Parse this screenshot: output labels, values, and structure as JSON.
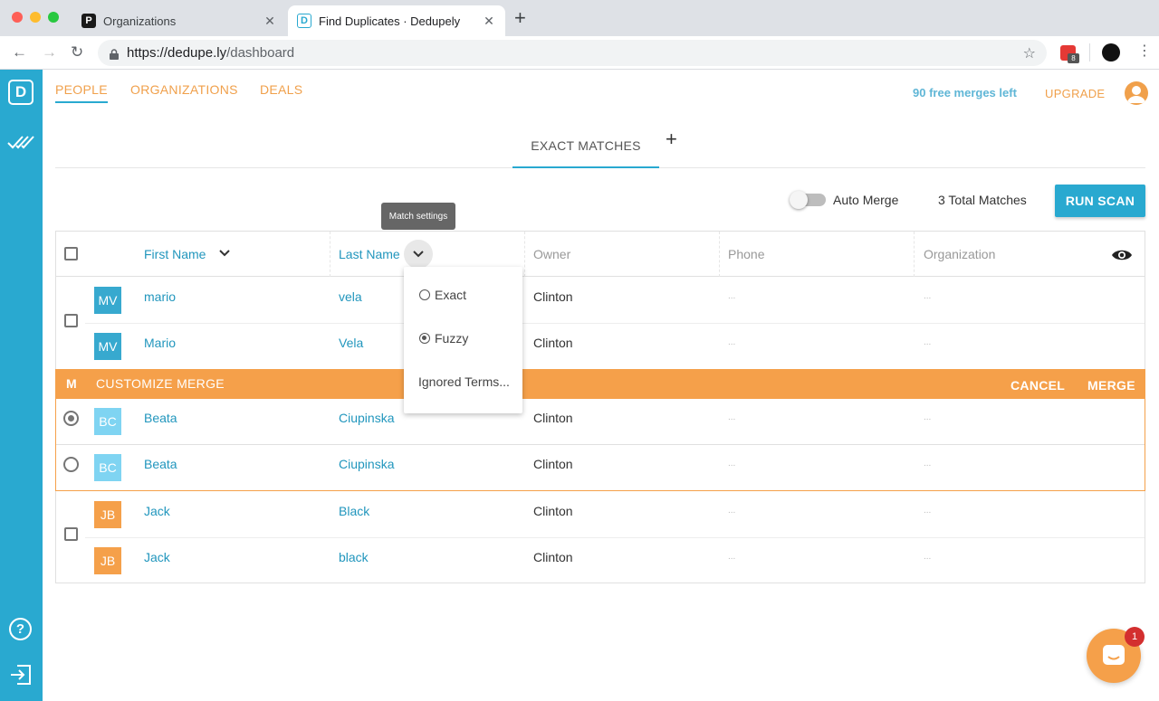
{
  "browser": {
    "tabs": [
      {
        "label": "Organizations",
        "favicon": "P"
      },
      {
        "label": "Find Duplicates · Dedupely",
        "favicon": "D"
      }
    ],
    "url_host": "https://dedupe.ly",
    "url_path": "/dashboard",
    "extension_badge": "8"
  },
  "sidebar": {
    "logo": "D",
    "help": "?"
  },
  "nav": {
    "tabs": [
      "PEOPLE",
      "ORGANIZATIONS",
      "DEALS"
    ],
    "free_merges": "90 free merges left",
    "upgrade": "UPGRADE"
  },
  "subtabs": {
    "exact": "EXACT MATCHES",
    "add": "+"
  },
  "tooltip": "Match settings",
  "toolbar": {
    "auto_merge_label": "Auto Merge",
    "auto_merge_on": false,
    "total_matches": "3 Total Matches",
    "run_scan": "RUN SCAN"
  },
  "table": {
    "columns": [
      "First Name",
      "Last Name",
      "Owner",
      "Phone",
      "Organization"
    ],
    "rows": [
      {
        "initials": "MV",
        "first": "mario",
        "last": "vela",
        "owner": "Clinton",
        "phone": "...",
        "org": "...",
        "color": "#37a9cf"
      },
      {
        "initials": "MV",
        "first": "Mario",
        "last": "Vela",
        "owner": "Clinton",
        "phone": "...",
        "org": "...",
        "color": "#37a9cf"
      },
      {
        "initials": "BC",
        "first": "Beata",
        "last": "Ciupinska",
        "owner": "Clinton",
        "phone": "...",
        "org": "...",
        "color": "#7fd4f2"
      },
      {
        "initials": "BC",
        "first": "Beata",
        "last": "Ciupinska",
        "owner": "Clinton",
        "phone": "...",
        "org": "...",
        "color": "#7fd4f2"
      },
      {
        "initials": "JB",
        "first": "Jack",
        "last": "Black",
        "owner": "Clinton",
        "phone": "...",
        "org": "...",
        "color": "#f5a04a"
      },
      {
        "initials": "JB",
        "first": "Jack",
        "last": "black",
        "owner": "Clinton",
        "phone": "...",
        "org": "...",
        "color": "#f5a04a"
      }
    ]
  },
  "merge_bar": {
    "badge": "M",
    "title": "CUSTOMIZE MERGE",
    "cancel": "CANCEL",
    "merge": "MERGE"
  },
  "dropdown": {
    "options": [
      "Exact",
      "Fuzzy"
    ],
    "selected": "Fuzzy",
    "ignored_terms": "Ignored Terms..."
  },
  "chat": {
    "unread": "1"
  },
  "colors": {
    "primary": "#29a9d0",
    "accent": "#f5a04a"
  }
}
